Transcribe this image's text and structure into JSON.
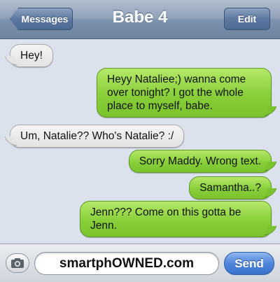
{
  "header": {
    "back_label": "Messages",
    "title": "Babe 4",
    "edit_label": "Edit"
  },
  "messages": [
    {
      "direction": "incoming",
      "text": "Hey!"
    },
    {
      "direction": "outgoing",
      "text": "Heyy Nataliee;) wanna come over tonight? I got the whole place to myself, babe."
    },
    {
      "direction": "incoming",
      "text": "Um, Natalie?? Who's Natalie? :/"
    },
    {
      "direction": "outgoing",
      "text": "Sorry Maddy. Wrong text."
    },
    {
      "direction": "outgoing",
      "text": "Samantha..?"
    },
    {
      "direction": "outgoing",
      "text": "Jenn??? Come on this gotta be Jenn."
    }
  ],
  "input_bar": {
    "camera_icon": "camera-icon",
    "field_text": "smartphOWNED.com",
    "send_label": "Send"
  },
  "colors": {
    "outgoing_bubble": "#88cf3a",
    "incoming_bubble": "#e9e9e9",
    "background": "#dbe2ed",
    "send_button": "#4f86dc"
  }
}
